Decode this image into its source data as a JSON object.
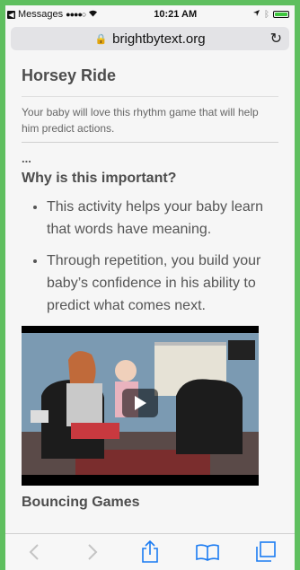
{
  "status": {
    "back_app": "Messages",
    "signal": "●●●●○",
    "time": "10:21 AM",
    "icons": [
      "wifi-icon",
      "location-icon",
      "bluetooth-icon",
      "battery-icon"
    ]
  },
  "address_bar": {
    "url": "brightbytext.org"
  },
  "article": {
    "title": "Horsey Ride",
    "intro": "Your baby will love this rhythm game that will help him predict actions.",
    "ellipsis": "...",
    "subtitle": "Why is this important?",
    "bullets": [
      "This activity helps your baby learn that words have meaning.",
      "Through repetition, you build your baby’s confidence in his ability to predict what comes next."
    ],
    "next_section": "Bouncing Games"
  },
  "colors": {
    "frame": "#5fbf5f",
    "accent": "#1a7bf2"
  }
}
